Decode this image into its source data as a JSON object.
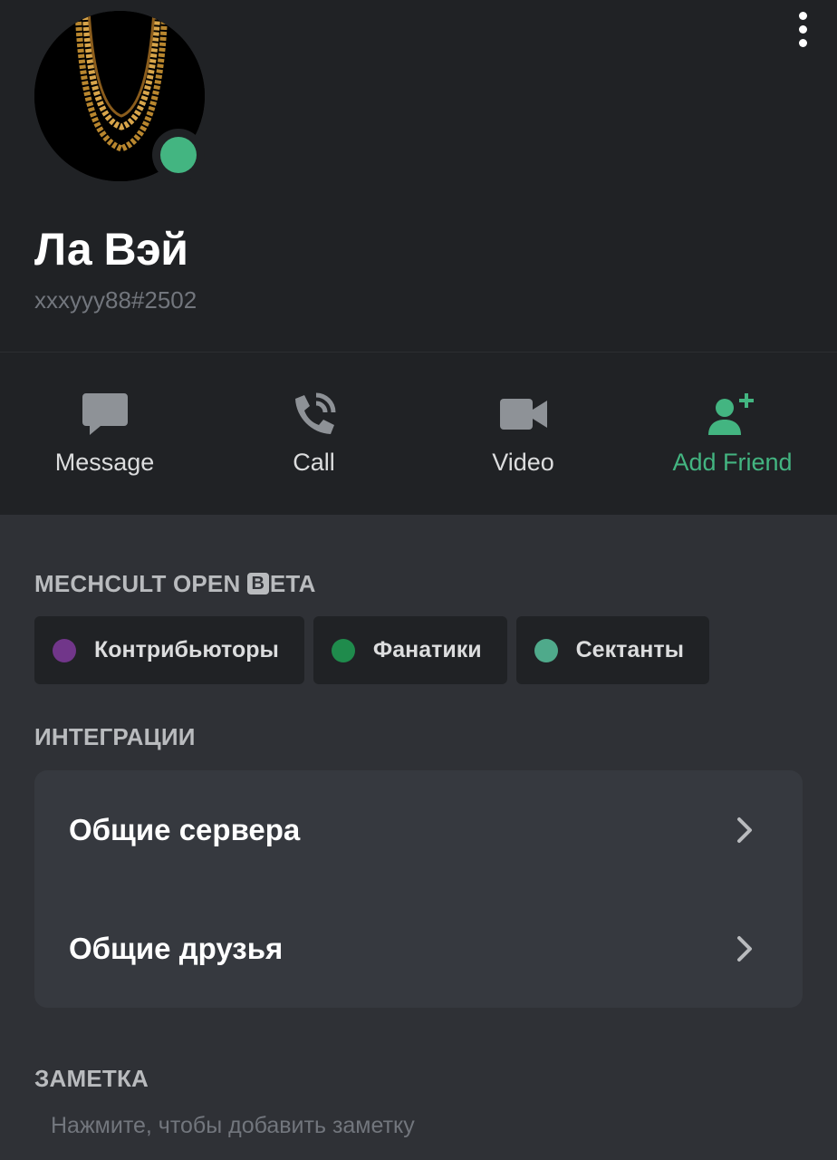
{
  "profile": {
    "display_name": "Ла Вэй",
    "user_tag": "xxxyyy88#2502",
    "status": "online",
    "status_color": "#43b581",
    "avatar_icon": "gold-chains-avatar"
  },
  "actions": [
    {
      "label": "Message",
      "icon": "chat-bubble-icon"
    },
    {
      "label": "Call",
      "icon": "phone-icon"
    },
    {
      "label": "Video",
      "icon": "video-camera-icon"
    },
    {
      "label": "Add Friend",
      "icon": "add-friend-icon",
      "color": "#43b581"
    }
  ],
  "server_section": {
    "title_pre": "MECHCULT OPEN ",
    "title_box": "B",
    "title_post": "ETA",
    "roles": [
      {
        "label": "Контрибьюторы",
        "color": "#71368a"
      },
      {
        "label": "Фанатики",
        "color": "#1f8b4c"
      },
      {
        "label": "Сектанты",
        "color": "#4faa8b"
      }
    ]
  },
  "integrations": {
    "title": "ИНТЕГРАЦИИ",
    "items": [
      {
        "label": "Общие сервера"
      },
      {
        "label": "Общие друзья"
      }
    ]
  },
  "note": {
    "title": "ЗАМЕТКА",
    "placeholder": "Нажмите, чтобы добавить заметку"
  }
}
